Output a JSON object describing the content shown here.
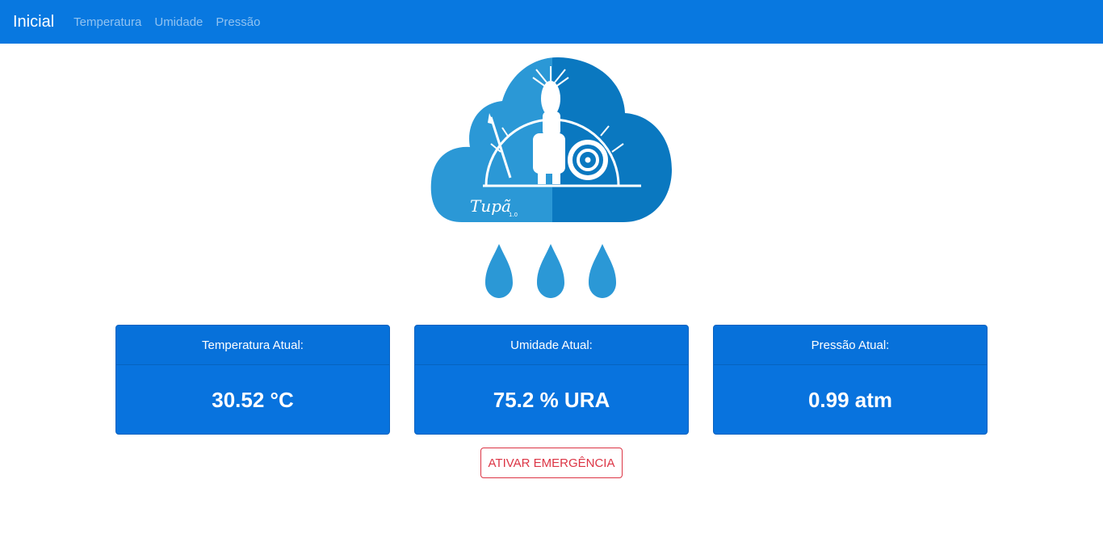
{
  "navbar": {
    "brand": "Inicial",
    "links": [
      "Temperatura",
      "Umidade",
      "Pressão"
    ]
  },
  "logo": {
    "text": "Tupã",
    "version": "1.0",
    "colors": {
      "light": "#2b98d6",
      "dark": "#0a78c0",
      "drop": "#2b98d6"
    }
  },
  "cards": [
    {
      "label": "Temperatura Atual:",
      "value": "30.52 °C"
    },
    {
      "label": "Umidade Atual:",
      "value": "75.2 % URA"
    },
    {
      "label": "Pressão Atual:",
      "value": "0.99 atm"
    }
  ],
  "actions": {
    "emergency_label": "ATIVAR EMERGÊNCIA"
  },
  "colors": {
    "primary": "#0878e0",
    "danger": "#dc3545"
  }
}
